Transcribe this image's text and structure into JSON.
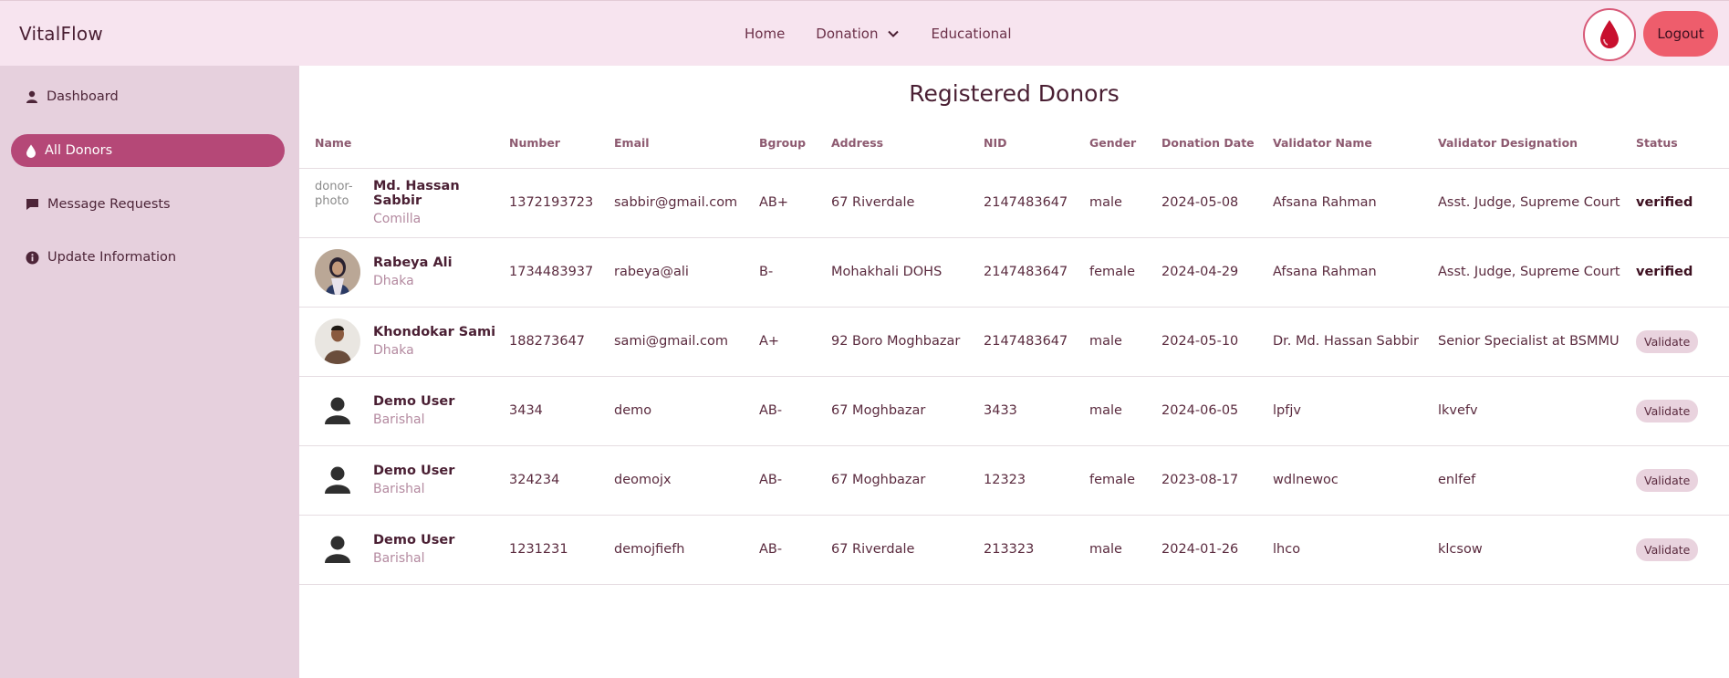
{
  "header": {
    "brand": "VitalFlow",
    "nav": [
      {
        "label": "Home"
      },
      {
        "label": "Donation"
      },
      {
        "label": "Educational"
      }
    ],
    "logout_label": "Logout",
    "accent": "#ee5d6c"
  },
  "sidebar": {
    "items": [
      {
        "label": "Dashboard",
        "icon": "user-icon"
      },
      {
        "label": "All Donors",
        "icon": "droplet-icon",
        "active": true
      },
      {
        "label": "Message Requests",
        "icon": "message-icon"
      },
      {
        "label": "Update Information",
        "icon": "info-icon"
      }
    ],
    "active_color": "#b54877"
  },
  "main": {
    "title": "Registered Donors",
    "columns": [
      "Name",
      "Number",
      "Email",
      "Bgroup",
      "Address",
      "NID",
      "Gender",
      "Donation Date",
      "Validator Name",
      "Validator Designation",
      "Status"
    ],
    "rows": [
      {
        "name": "Md. Hassan Sabbir",
        "city": "Comilla",
        "avatar": "broken",
        "avatar_alt": "donor-photo",
        "number": "1372193723",
        "email": "sabbir@gmail.com",
        "bgroup": "AB+",
        "address": "67 Riverdale",
        "nid": "2147483647",
        "gender": "male",
        "date": "2024-05-08",
        "validator": "Afsana Rahman",
        "designation": "Asst. Judge, Supreme Court",
        "status": "verified"
      },
      {
        "name": "Rabeya Ali",
        "city": "Dhaka",
        "avatar": "photo-woman",
        "number": "1734483937",
        "email": "rabeya@ali",
        "bgroup": "B-",
        "address": "Mohakhali DOHS",
        "nid": "2147483647",
        "gender": "female",
        "date": "2024-04-29",
        "validator": "Afsana Rahman",
        "designation": "Asst. Judge, Supreme Court",
        "status": "verified"
      },
      {
        "name": "Khondokar Sami",
        "city": "Dhaka",
        "avatar": "photo-man",
        "number": "188273647",
        "email": "sami@gmail.com",
        "bgroup": "A+",
        "address": "92 Boro Moghbazar",
        "nid": "2147483647",
        "gender": "male",
        "date": "2024-05-10",
        "validator": "Dr. Md. Hassan Sabbir",
        "designation": "Senior Specialist at BSMMU",
        "status": "Validate"
      },
      {
        "name": "Demo User",
        "city": "Barishal",
        "avatar": "default",
        "number": "3434",
        "email": "demo",
        "bgroup": "AB-",
        "address": "67 Moghbazar",
        "nid": "3433",
        "gender": "male",
        "date": "2024-06-05",
        "validator": "lpfjv",
        "designation": "lkvefv",
        "status": "Validate"
      },
      {
        "name": "Demo User",
        "city": "Barishal",
        "avatar": "default",
        "number": "324234",
        "email": "deomojx",
        "bgroup": "AB-",
        "address": "67 Moghbazar",
        "nid": "12323",
        "gender": "female",
        "date": "2023-08-17",
        "validator": "wdlnewoc",
        "designation": "enlfef",
        "status": "Validate"
      },
      {
        "name": "Demo User",
        "city": "Barishal",
        "avatar": "default",
        "number": "1231231",
        "email": "demojfiefh",
        "bgroup": "AB-",
        "address": "67 Riverdale",
        "nid": "213323",
        "gender": "male",
        "date": "2024-01-26",
        "validator": "lhco",
        "designation": "klcsow",
        "status": "Validate"
      }
    ]
  }
}
